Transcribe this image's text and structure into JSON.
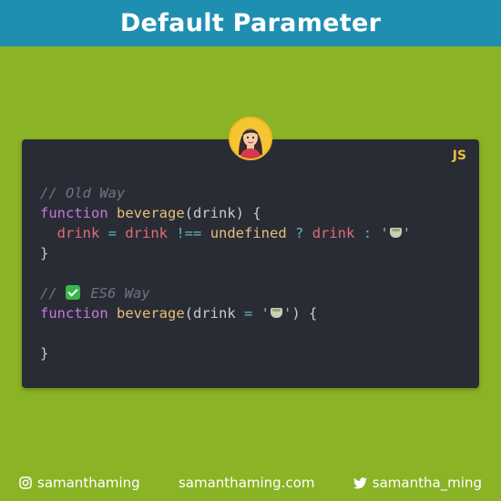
{
  "header": {
    "title": "Default Parameter"
  },
  "card": {
    "lang": "JS",
    "code_lines": [
      [
        {
          "t": "// Old Way",
          "c": "comment"
        }
      ],
      [
        {
          "t": "function ",
          "c": "kw"
        },
        {
          "t": "beverage",
          "c": "fn"
        },
        {
          "t": "(",
          "c": "punc"
        },
        {
          "t": "drink",
          "c": "punc"
        },
        {
          "t": ") {",
          "c": "punc"
        }
      ],
      [
        {
          "t": "  ",
          "c": "punc"
        },
        {
          "t": "drink",
          "c": "var"
        },
        {
          "t": " = ",
          "c": "op"
        },
        {
          "t": "drink",
          "c": "var"
        },
        {
          "t": " !== ",
          "c": "op"
        },
        {
          "t": "undefined",
          "c": "und"
        },
        {
          "t": " ? ",
          "c": "op"
        },
        {
          "t": "drink",
          "c": "var"
        },
        {
          "t": " : ",
          "c": "op"
        },
        {
          "t": "'",
          "c": "str"
        },
        {
          "t": "tea",
          "c": "emoji-tea"
        },
        {
          "t": "'",
          "c": "str"
        }
      ],
      [
        {
          "t": "}",
          "c": "punc"
        }
      ],
      [
        {
          "t": "",
          "c": "punc"
        }
      ],
      [
        {
          "t": "// ",
          "c": "comment"
        },
        {
          "t": "check",
          "c": "emoji-check"
        },
        {
          "t": " ES6 Way",
          "c": "comment"
        }
      ],
      [
        {
          "t": "function ",
          "c": "kw"
        },
        {
          "t": "beverage",
          "c": "fn"
        },
        {
          "t": "(",
          "c": "punc"
        },
        {
          "t": "drink",
          "c": "punc"
        },
        {
          "t": " = ",
          "c": "op"
        },
        {
          "t": "'",
          "c": "str"
        },
        {
          "t": "tea",
          "c": "emoji-tea"
        },
        {
          "t": "'",
          "c": "str"
        },
        {
          "t": ") {",
          "c": "punc"
        }
      ],
      [
        {
          "t": "",
          "c": "punc"
        }
      ],
      [
        {
          "t": "}",
          "c": "punc"
        }
      ]
    ]
  },
  "footer": {
    "instagram": "samanthaming",
    "website": "samanthaming.com",
    "twitter": "samantha_ming"
  },
  "colors": {
    "background": "#8ab325",
    "header": "#1f8fb1",
    "code_bg": "#2a2c35",
    "lang_badge": "#e8bf3a",
    "avatar_ring": "#f6c533"
  },
  "icons": {
    "avatar": "avatar-icon",
    "instagram": "instagram-icon",
    "twitter": "twitter-icon"
  }
}
